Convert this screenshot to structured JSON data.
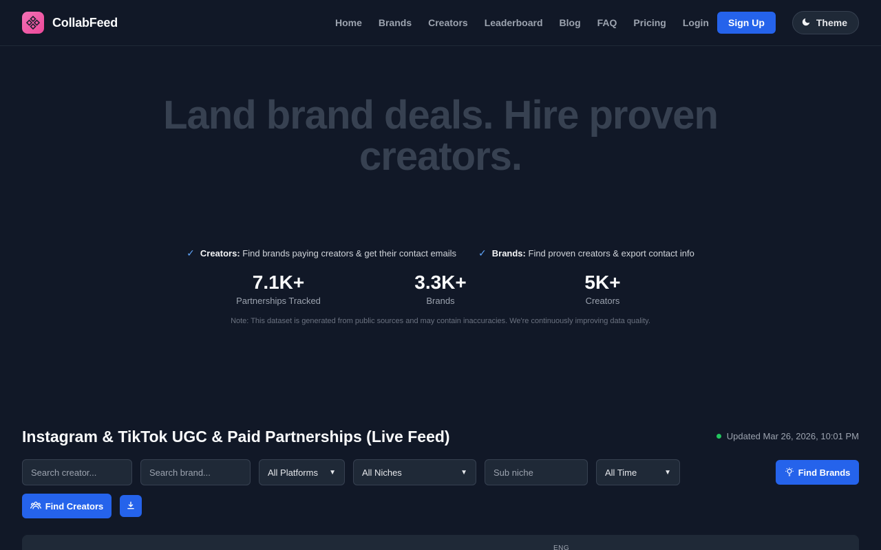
{
  "brand": {
    "name": "CollabFeed"
  },
  "nav": {
    "links": [
      "Home",
      "Brands",
      "Creators",
      "Leaderboard",
      "Blog",
      "FAQ",
      "Pricing",
      "Login"
    ],
    "signup_label": "Sign Up",
    "theme_label": "Theme"
  },
  "hero": {
    "title": "Land brand deals. Hire proven creators.",
    "features": [
      {
        "bold": "Creators:",
        "text": "Find brands paying creators & get their contact emails"
      },
      {
        "bold": "Brands:",
        "text": "Find proven creators & export contact info"
      }
    ],
    "stats": [
      {
        "value": "7.1K+",
        "label": "Partnerships Tracked"
      },
      {
        "value": "3.3K+",
        "label": "Brands"
      },
      {
        "value": "5K+",
        "label": "Creators"
      }
    ],
    "note": "Note: This dataset is generated from public sources and may contain inaccuracies. We're continuously improving data quality."
  },
  "feed": {
    "title": "Instagram & TikTok UGC & Paid Partnerships (Live Feed)",
    "updated": "Updated Mar 26, 2026, 10:01 PM",
    "status_color": "#22c55e",
    "filters": {
      "creator_placeholder": "Search creator...",
      "brand_placeholder": "Search brand...",
      "platform": "All Platforms",
      "niche": "All Niches",
      "subniche_placeholder": "Sub niche",
      "time": "All Time"
    },
    "find_brands_label": "Find Brands",
    "find_creators_label": "Find Creators",
    "table_header_partial": "ENG"
  },
  "colors": {
    "accent": "#2563eb",
    "background": "#111827",
    "logo": "#ec4899"
  }
}
